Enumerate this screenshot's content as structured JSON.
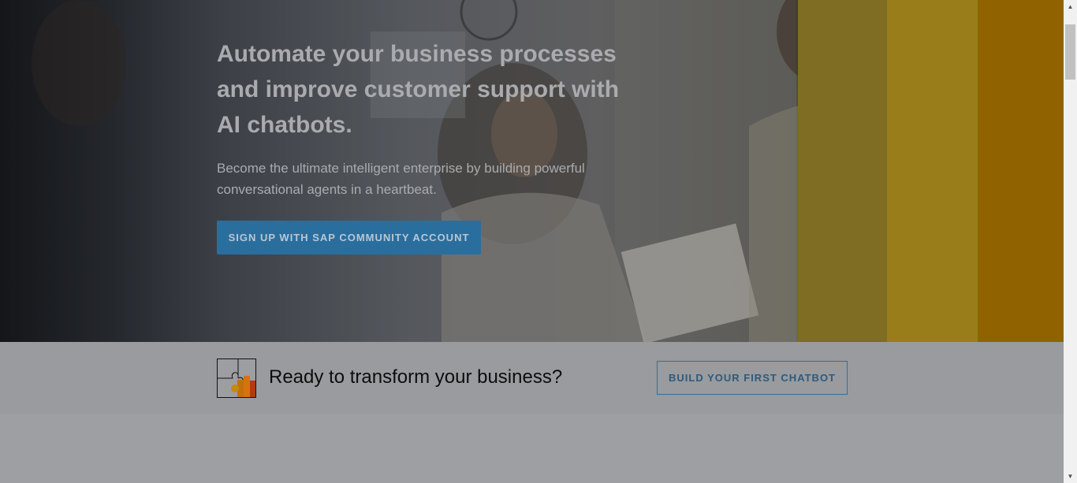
{
  "hero": {
    "title_line1": "Automate your business processes",
    "title_line2": "and improve customer support with",
    "title_line3": "AI chatbots.",
    "subtitle_line1": "Become the ultimate intelligent enterprise by building powerful",
    "subtitle_line2": "conversational agents in a heartbeat.",
    "cta_label": "SIGN UP WITH SAP COMMUNITY ACCOUNT"
  },
  "transform": {
    "icon": "puzzle-icon",
    "text": "Ready to transform your business?",
    "cta_label": "BUILD YOUR FIRST CHATBOT"
  },
  "colors": {
    "primary_button": "#2a6e9e",
    "outline_button": "#3a6c93",
    "yellow_bands": [
      "#7e6d22",
      "#9a7d1b",
      "#916300"
    ]
  },
  "scrollbar": {
    "up_icon": "scroll-up-arrow-icon",
    "down_icon": "scroll-down-arrow-icon"
  }
}
